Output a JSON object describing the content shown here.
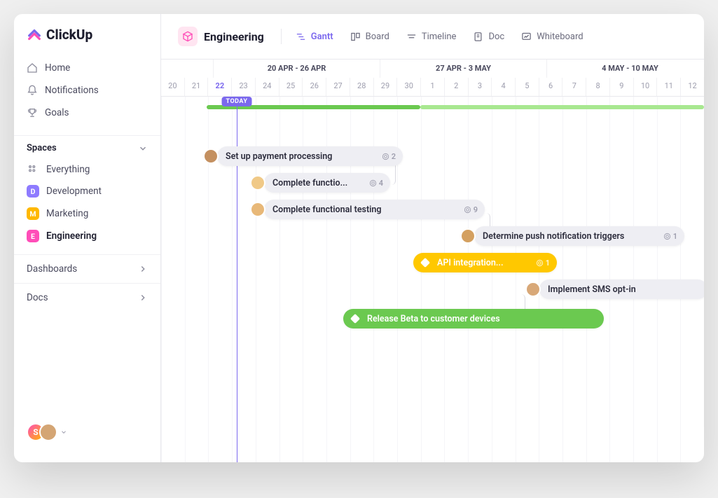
{
  "brand": "ClickUp",
  "nav": {
    "home": "Home",
    "notifications": "Notifications",
    "goals": "Goals"
  },
  "spaces": {
    "header": "Spaces",
    "everything": "Everything",
    "items": [
      {
        "letter": "D",
        "label": "Development",
        "color": "#8e7bff"
      },
      {
        "letter": "M",
        "label": "Marketing",
        "color": "#ffb800"
      },
      {
        "letter": "E",
        "label": "Engineering",
        "color": "#ff4db8"
      }
    ]
  },
  "collapse": {
    "dashboards": "Dashboards",
    "docs": "Docs"
  },
  "header": {
    "space": "Engineering",
    "views": {
      "gantt": "Gantt",
      "board": "Board",
      "timeline": "Timeline",
      "doc": "Doc",
      "whiteboard": "Whiteboard"
    }
  },
  "timeline": {
    "weeks": [
      "20 APR - 26 APR",
      "27 APR - 3 MAY",
      "4 MAY - 10 MAY"
    ],
    "days": [
      "20",
      "21",
      "22",
      "23",
      "24",
      "25",
      "26",
      "27",
      "28",
      "29",
      "30",
      "1",
      "2",
      "3",
      "4",
      "5",
      "6",
      "7",
      "8",
      "9",
      "10",
      "11",
      "12"
    ],
    "today_label": "TODAY",
    "today_index": 2
  },
  "tasks": [
    {
      "label": "Set up payment processing",
      "count": "2"
    },
    {
      "label": "Complete functio...",
      "count": "4"
    },
    {
      "label": "Complete functional testing",
      "count": "9"
    },
    {
      "label": "Determine push notification triggers",
      "count": "1"
    },
    {
      "label": "API integration...",
      "count": "1"
    },
    {
      "label": "Implement SMS opt-in",
      "count": ""
    },
    {
      "label": "Release Beta to customer devices",
      "count": ""
    }
  ],
  "users": {
    "initial": "S"
  }
}
